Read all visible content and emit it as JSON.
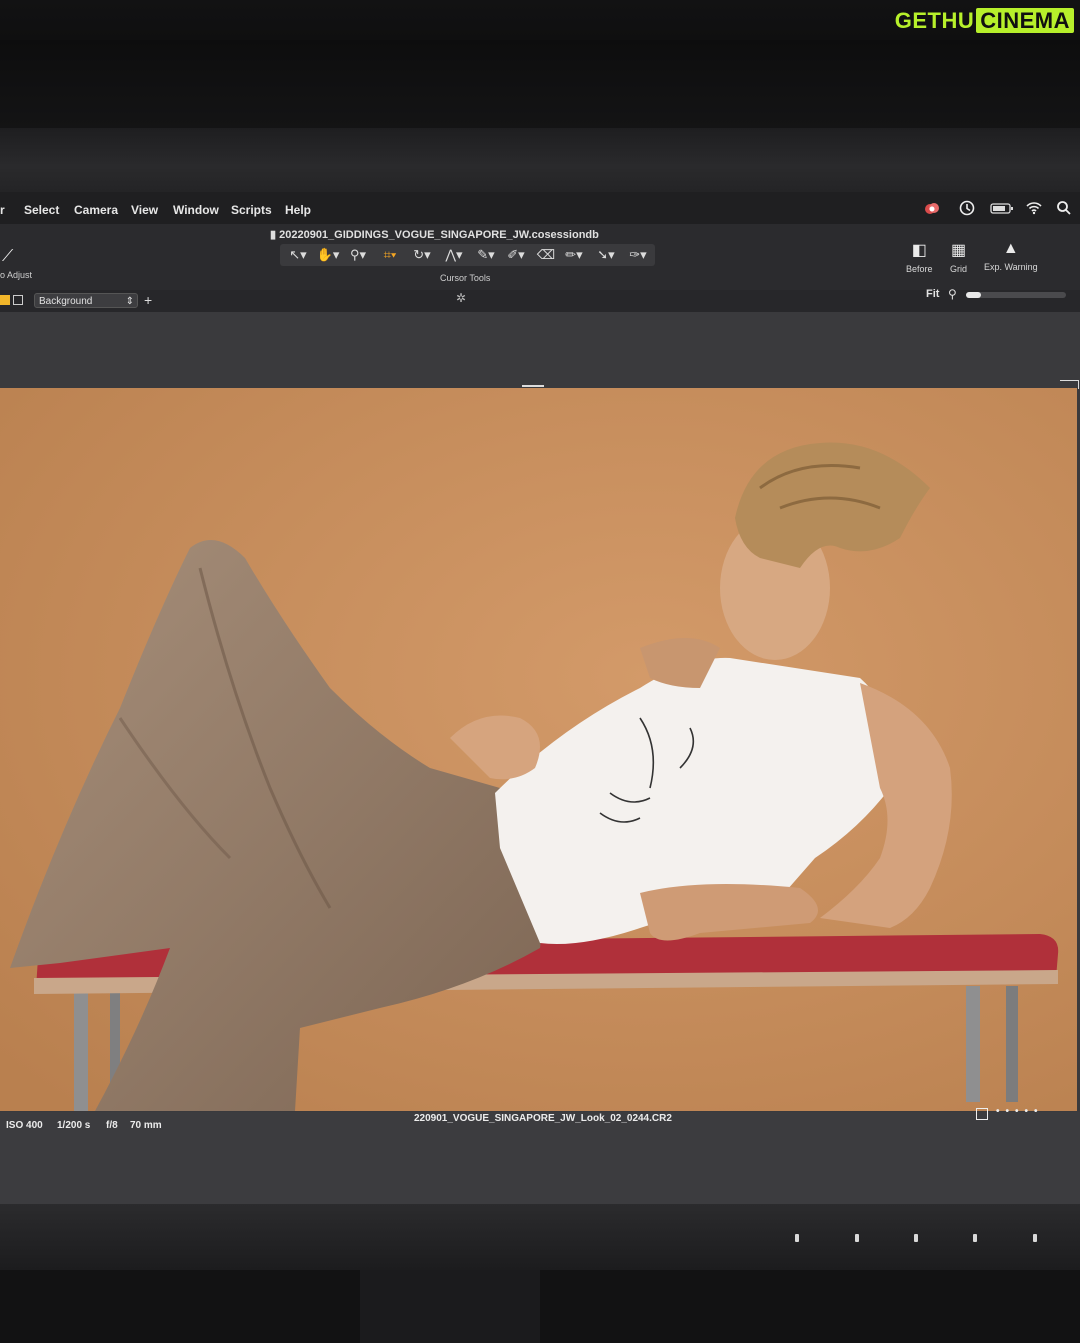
{
  "watermark": {
    "part1": "GETHU",
    "part2": "CINEMA"
  },
  "menu": {
    "items": [
      "Select",
      "Camera",
      "View",
      "Window",
      "Scripts",
      "Help"
    ],
    "partial_left": "r"
  },
  "toolbar": {
    "file_title": "20220901_GIDDINGS_VOGUE_SINGAPORE_JW.cosessiondb",
    "cursor_tools_label": "Cursor Tools",
    "auto_adjust_label": "o Adjust",
    "before_label": "Before",
    "grid_label": "Grid",
    "exp_warning_label": "Exp. Warning"
  },
  "subbar": {
    "layer_value": "Background",
    "fit_label": "Fit",
    "zoom_level": 0.15
  },
  "info": {
    "iso": "ISO 400",
    "shutter": "1/200 s",
    "aperture": "f/8",
    "focal_length": "70 mm",
    "file_name": "220901_VOGUE_SINGAPORE_JW_Look_02_0244.CR2"
  },
  "colors": {
    "backdrop": "#c98f5f",
    "bench_top": "#b8323a",
    "trousers": "#9b826d",
    "tank_top": "#f4f1ee",
    "hair": "#b58c5a",
    "skin": "#d4a27d"
  },
  "icons": {
    "status": [
      "creative-cloud-icon",
      "clock-icon",
      "battery-icon",
      "wifi-icon",
      "search-icon"
    ],
    "tools": [
      "pointer-icon",
      "hand-icon",
      "zoom-icon",
      "crop-icon",
      "rotate-icon",
      "keystone-icon",
      "picker-icon",
      "brush-icon",
      "eraser-icon",
      "gradient-icon",
      "annotate-icon",
      "pen-icon"
    ]
  }
}
